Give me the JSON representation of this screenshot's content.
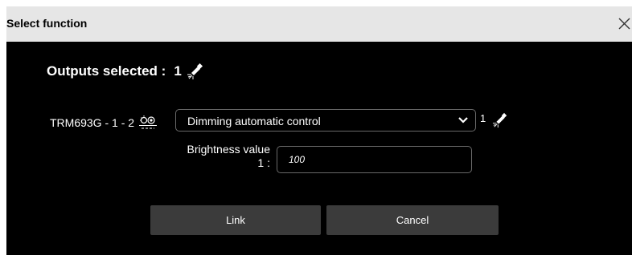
{
  "dialog": {
    "title": "Select function",
    "close_icon": "close-icon"
  },
  "outputs": {
    "label": "Outputs selected :",
    "count": "1",
    "icon": "lamp-icon"
  },
  "device": {
    "name": "TRM693G - 1 - 2",
    "icon": "sensor-icon"
  },
  "function_select": {
    "selected_value": "Dimming automatic control",
    "icon": "chevron-down-icon",
    "count": "1"
  },
  "brightness": {
    "label_line1": "Brightness value",
    "label_line2": "1 :",
    "value": "100"
  },
  "buttons": {
    "link_label": "Link",
    "cancel_label": "Cancel"
  },
  "colors": {
    "title_bar": "#e6e6e6",
    "body_bg": "#000000",
    "button_bg": "#3b3b3b",
    "border": "#6a6a6a"
  }
}
